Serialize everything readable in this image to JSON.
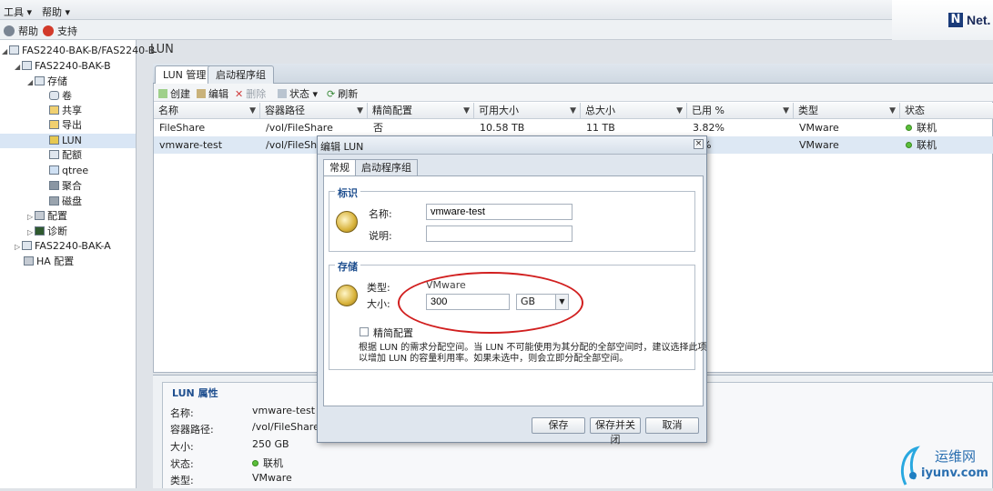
{
  "menu": {
    "tools": "工具 ▾",
    "help": "帮助 ▾"
  },
  "quickbar": {
    "help": "帮助",
    "support": "支持"
  },
  "brand": {
    "logo_letter": "N",
    "logo_text": "Net."
  },
  "tree": {
    "root": "FAS2240-BAK-B/FAS2240-B",
    "node_b": "FAS2240-BAK-B",
    "storage": "存储",
    "volume": "卷",
    "share": "共享",
    "export": "导出",
    "lun": "LUN",
    "quota": "配额",
    "qtree": "qtree",
    "aggregate": "聚合",
    "disk": "磁盘",
    "config": "配置",
    "diag": "诊断",
    "node_a": "FAS2240-BAK-A",
    "ha": "HA 配置"
  },
  "main": {
    "title": "LUN",
    "tabs": [
      "LUN 管理",
      "启动程序组"
    ],
    "actions": {
      "create": "创建",
      "edit": "编辑",
      "delete": "删除",
      "status": "状态 ▾",
      "refresh": "刷新"
    },
    "columns": [
      "名称",
      "容器路径",
      "精简配置",
      "可用大小",
      "总大小",
      "已用 %",
      "类型",
      "状态"
    ],
    "rows": [
      {
        "name": "FileShare",
        "path": "/vol/FileShare",
        "thin": "否",
        "avail": "10.58 TB",
        "total": "11 TB",
        "used": "3.82%",
        "type": "VMware",
        "status": "联机"
      },
      {
        "name": "vmware-test",
        "path": "/vol/FileShare",
        "used": "%",
        "type": "VMware",
        "status": "联机"
      }
    ]
  },
  "props": {
    "title": "LUN 属性",
    "labels": {
      "name": "名称:",
      "path": "容器路径:",
      "size": "大小:",
      "status": "状态:",
      "type": "类型:"
    },
    "values": {
      "name": "vmware-test",
      "path": "/vol/FileShare",
      "size": "250 GB",
      "status": "联机",
      "type": "VMware"
    }
  },
  "dialog": {
    "title": "编辑 LUN",
    "close": "×",
    "tabs": [
      "常规",
      "启动程序组"
    ],
    "ident": {
      "legend": "标识",
      "name_label": "名称:",
      "name_value": "vmware-test",
      "desc_label": "说明:",
      "desc_value": ""
    },
    "storage": {
      "legend": "存储",
      "type_label": "类型:",
      "type_value": "VMware",
      "size_label": "大小:",
      "size_value": "300",
      "unit": "GB",
      "thin_label": "精简配置",
      "note_line1": "根据 LUN 的需求分配空间。当 LUN 不可能使用为其分配的全部空间时，建议选择此项",
      "note_line2": "以增加 LUN 的容量利用率。如果未选中，则会立即分配全部空间。"
    },
    "buttons": {
      "save": "保存",
      "save_close": "保存并关闭",
      "cancel": "取消"
    }
  },
  "watermark": {
    "cn": "运维网",
    "en": "iyunv.com"
  },
  "colors": {
    "accent": "#1f4f8f",
    "highlight": "#d11f1f",
    "online": "#5bbf3a"
  }
}
